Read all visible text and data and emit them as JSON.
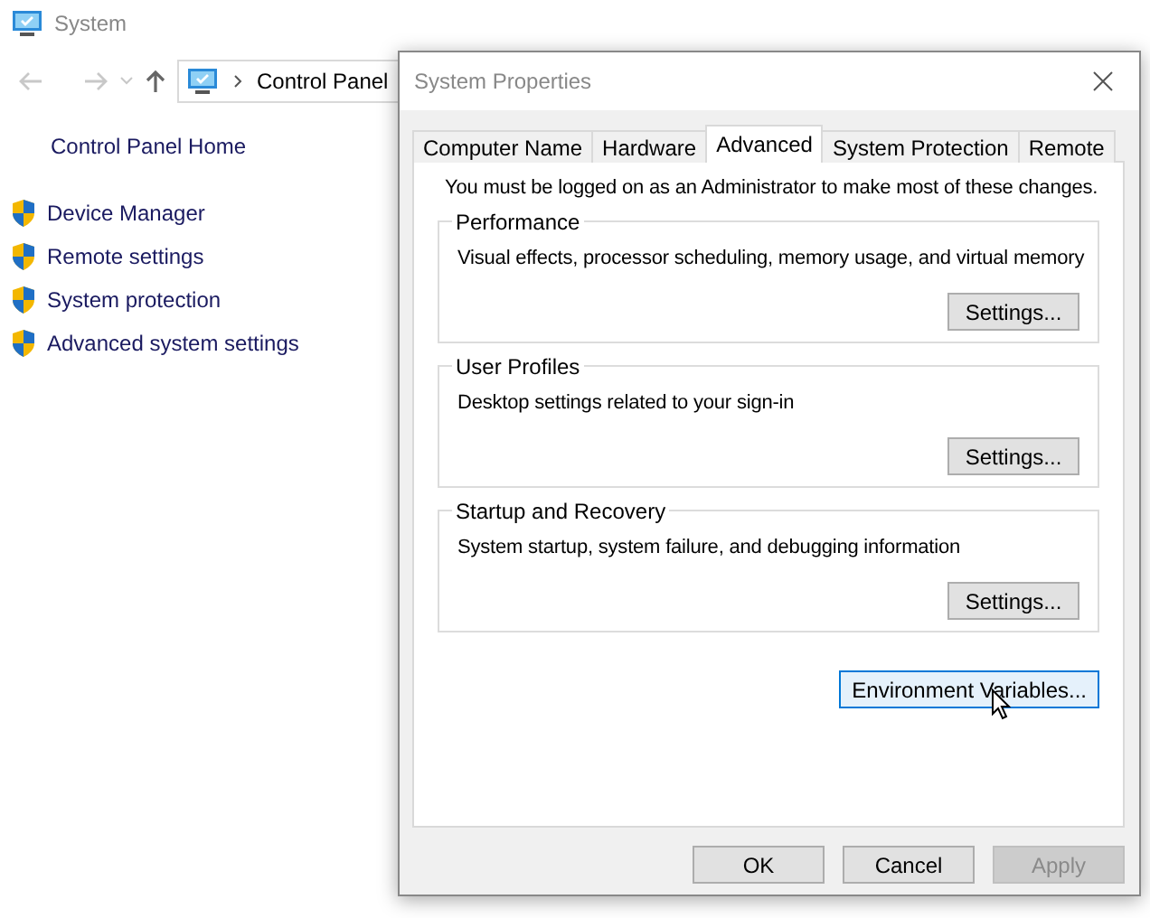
{
  "window": {
    "title": "System"
  },
  "address_bar": {
    "crumbs": [
      "Control Panel"
    ]
  },
  "sidebar": {
    "home": "Control Panel Home",
    "links": [
      "Device Manager",
      "Remote settings",
      "System protection",
      "Advanced system settings"
    ]
  },
  "dialog": {
    "title": "System Properties",
    "tabs": [
      {
        "label": "Computer Name",
        "selected": false
      },
      {
        "label": "Hardware",
        "selected": false
      },
      {
        "label": "Advanced",
        "selected": true
      },
      {
        "label": "System Protection",
        "selected": false
      },
      {
        "label": "Remote",
        "selected": false
      }
    ],
    "notice": "You must be logged on as an Administrator to make most of these changes.",
    "groups": [
      {
        "title": "Performance",
        "description": "Visual effects, processor scheduling, memory usage, and virtual memory",
        "button": "Settings..."
      },
      {
        "title": "User Profiles",
        "description": "Desktop settings related to your sign-in",
        "button": "Settings..."
      },
      {
        "title": "Startup and Recovery",
        "description": "System startup, system failure, and debugging information",
        "button": "Settings..."
      }
    ],
    "environment_button": {
      "label": "Environment Variables...",
      "focused": true
    },
    "footer_buttons": [
      {
        "label": "OK",
        "disabled": false
      },
      {
        "label": "Cancel",
        "disabled": false
      },
      {
        "label": "Apply",
        "disabled": true
      }
    ]
  }
}
